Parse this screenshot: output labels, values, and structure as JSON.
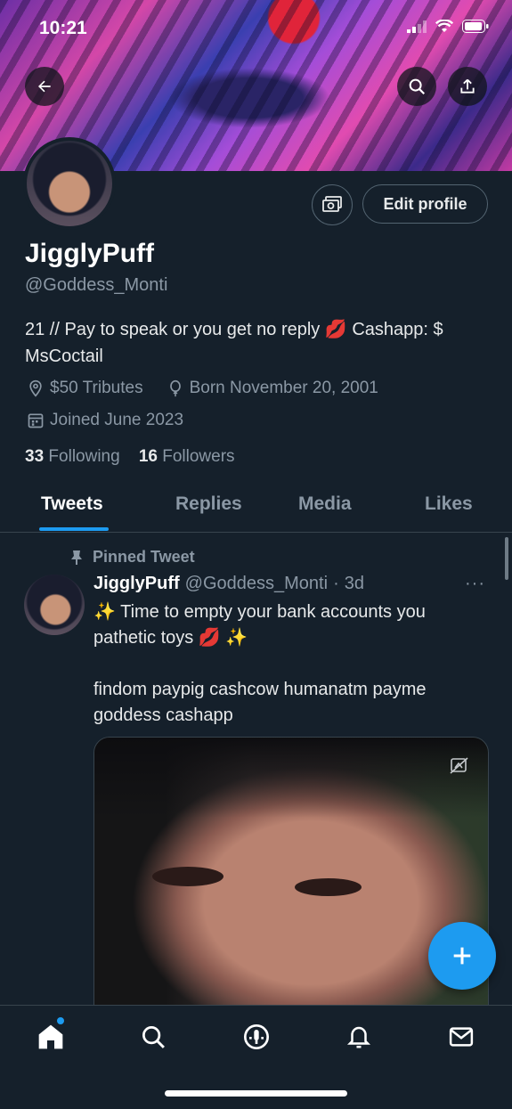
{
  "status_bar": {
    "time": "10:21"
  },
  "profile": {
    "name": "JigglyPuff",
    "handle": "@Goddess_Monti",
    "bio": "21 // Pay to speak or you get no reply 💋 Cashapp: $ MsCoctail",
    "location": "$50 Tributes",
    "birthday": "Born November 20, 2001",
    "joined": "Joined June 2023",
    "following_count": "33",
    "following_label": "Following",
    "followers_count": "16",
    "followers_label": "Followers",
    "edit_profile_label": "Edit profile"
  },
  "tabs": [
    {
      "label": "Tweets",
      "active": true
    },
    {
      "label": "Replies"
    },
    {
      "label": "Media"
    },
    {
      "label": "Likes"
    }
  ],
  "pinned_tweet": {
    "pinned_label": "Pinned Tweet",
    "author_name": "JigglyPuff",
    "author_handle": "@Goddess_Monti",
    "separator": "·",
    "time": "3d",
    "more": "···",
    "text_line1": "✨ Time to empty your bank accounts you pathetic toys 💋 ✨",
    "text_line2": "findom paypig cashcow humanatm payme goddess cashapp"
  },
  "icons": {
    "back": "back-arrow-icon",
    "search": "search-icon",
    "share": "share-icon",
    "message": "message-icon",
    "location": "location-pin-icon",
    "birthday": "balloon-icon",
    "calendar": "calendar-icon",
    "pin": "pin-icon",
    "sensitive": "sensitive-media-icon",
    "compose": "plus-icon"
  },
  "nav": [
    "home-icon",
    "search-icon",
    "spaces-icon",
    "notifications-icon",
    "messages-icon"
  ],
  "colors": {
    "accent": "#1d9bf0",
    "background": "#15202b",
    "secondary_text": "#8b98a5"
  }
}
